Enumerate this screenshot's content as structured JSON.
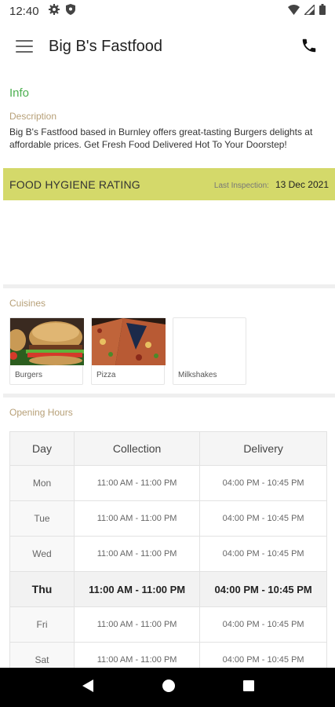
{
  "status_bar": {
    "time": "12:40"
  },
  "app_bar": {
    "title": "Big B's Fastfood"
  },
  "info": {
    "heading": "Info",
    "description_label": "Description",
    "description": "Big B's Fastfood based in Burnley offers great-tasting Burgers delights at affordable prices. Get Fresh Food Delivered Hot To Your Doorstep!"
  },
  "hygiene": {
    "title": "FOOD HYGIENE RATING",
    "inspection_label": "Last Inspection:",
    "inspection_date": "13 Dec 2021"
  },
  "cuisines": {
    "label": "Cuisines",
    "items": [
      {
        "name": "Burgers"
      },
      {
        "name": "Pizza"
      },
      {
        "name": "Milkshakes"
      }
    ]
  },
  "opening_hours": {
    "label": "Opening Hours",
    "headers": [
      "Day",
      "Collection",
      "Delivery"
    ],
    "rows": [
      {
        "day": "Mon",
        "collection": "11:00 AM - 11:00 PM",
        "delivery": "04:00 PM - 10:45 PM"
      },
      {
        "day": "Tue",
        "collection": "11:00 AM - 11:00 PM",
        "delivery": "04:00 PM - 10:45 PM"
      },
      {
        "day": "Wed",
        "collection": "11:00 AM - 11:00 PM",
        "delivery": "04:00 PM - 10:45 PM"
      },
      {
        "day": "Thu",
        "collection": "11:00 AM - 11:00 PM",
        "delivery": "04:00 PM - 10:45 PM"
      },
      {
        "day": "Fri",
        "collection": "11:00 AM - 11:00 PM",
        "delivery": "04:00 PM - 10:45 PM"
      },
      {
        "day": "Sat",
        "collection": "11:00 AM - 11:00 PM",
        "delivery": "04:00 PM - 10:45 PM"
      }
    ],
    "highlighted_day": "Thu"
  },
  "colors": {
    "accent_green": "#4caf50",
    "hygiene_band": "#d4d96a",
    "section_label": "#b7a078"
  },
  "icons": {
    "status": [
      "gear-icon",
      "shield-icon",
      "wifi-icon",
      "signal-icon",
      "battery-icon"
    ],
    "app_bar": [
      "hamburger-menu-icon",
      "phone-icon"
    ],
    "nav": [
      "back-icon",
      "home-icon",
      "recents-icon"
    ]
  }
}
